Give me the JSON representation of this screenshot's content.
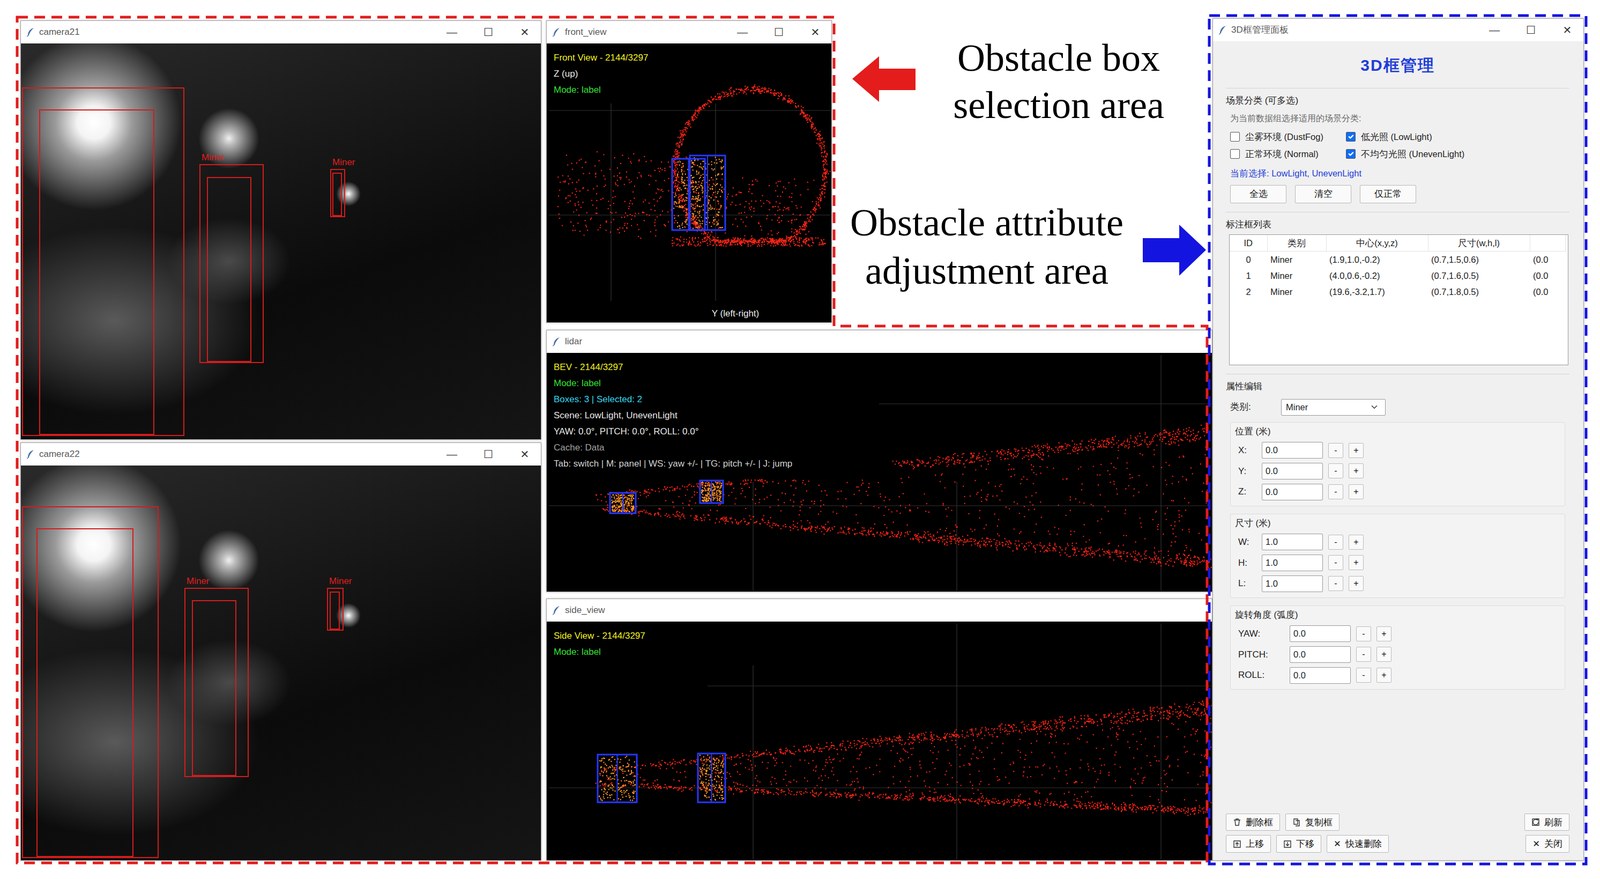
{
  "window_controls": [
    "—",
    "☐",
    "✕"
  ],
  "selection_label": {
    "lines": [
      "Obstacle box",
      "selection area"
    ]
  },
  "attribute_label": {
    "lines": [
      "Obstacle attribute",
      "adjustment area"
    ]
  },
  "cameras": [
    {
      "title": "camera21",
      "boxes": [
        {},
        {
          "label": "Miner"
        },
        {
          "label": "Miner"
        }
      ]
    },
    {
      "title": "camera22",
      "boxes": [
        {},
        {
          "label": "Miner"
        },
        {
          "label": "Miner"
        }
      ]
    }
  ],
  "front_view": {
    "title": "front_view",
    "lines": [
      {
        "text": "Front View - 2144/3297",
        "kind": "title"
      },
      {
        "text": "Z (up)",
        "kind": "axis"
      },
      {
        "text": "Mode: label",
        "kind": "mode"
      }
    ],
    "axis": "Y (left-right)"
  },
  "lidar": {
    "title": "lidar",
    "lines": [
      {
        "text": "BEV - 2144/3297",
        "kind": "title"
      },
      {
        "text": "Mode: label",
        "kind": "mode"
      },
      {
        "text": "Boxes: 3 | Selected: 2",
        "kind": "count"
      },
      {
        "text": "Scene: LowLight, UnevenLight",
        "kind": "info"
      },
      {
        "text": "YAW: 0.0°, PITCH: 0.0°, ROLL: 0.0°",
        "kind": "info"
      },
      {
        "text": "Cache: Data",
        "kind": "cache"
      },
      {
        "text": "Tab: switch | M: panel | WS: yaw +/- | TG: pitch +/- | J: jump",
        "kind": "keys"
      }
    ]
  },
  "side_view": {
    "title": "side_view",
    "lines": [
      {
        "text": "Side View - 2144/3297",
        "kind": "title"
      },
      {
        "text": "Mode: label",
        "kind": "mode"
      }
    ]
  },
  "panel": {
    "title": "3D框管理面板",
    "heading": "3D框管理",
    "scene": {
      "title": "场景分类 (可多选)",
      "hint": "为当前数据组选择适用的场景分类:",
      "options": [
        {
          "label": "尘雾环境 (DustFog)",
          "checked": false
        },
        {
          "label": "低光照 (LowLight)",
          "checked": true
        },
        {
          "label": "正常环境 (Normal)",
          "checked": false
        },
        {
          "label": "不均匀光照 (UnevenLight)",
          "checked": true
        }
      ],
      "current": "当前选择: LowLight, UnevenLight",
      "buttons": [
        "全选",
        "清空",
        "仅正常"
      ]
    },
    "box_list": {
      "title": "标注框列表",
      "columns": [
        "ID",
        "类别",
        "中心(x,y,z)",
        "尺寸(w,h,l)"
      ],
      "rows": [
        [
          "0",
          "Miner",
          "(1.9,1.0,-0.2)",
          "(0.7,1.5,0.6)",
          "(0.0"
        ],
        [
          "1",
          "Miner",
          "(4.0,0.6,-0.2)",
          "(0.7,1.6,0.5)",
          "(0.0"
        ],
        [
          "2",
          "Miner",
          "(19.6,-3.2,1.7)",
          "(0.7,1.8,0.5)",
          "(0.0"
        ]
      ]
    },
    "attributes": {
      "title": "属性编辑",
      "category_label": "类别:",
      "category": "Miner",
      "minus": "-",
      "plus": "+",
      "groups": [
        {
          "title": "位置 (米)",
          "fields": [
            {
              "label": "X:",
              "value": "0.0"
            },
            {
              "label": "Y:",
              "value": "0.0"
            },
            {
              "label": "Z:",
              "value": "0.0"
            }
          ]
        },
        {
          "title": "尺寸 (米)",
          "fields": [
            {
              "label": "W:",
              "value": "1.0"
            },
            {
              "label": "H:",
              "value": "1.0"
            },
            {
              "label": "L:",
              "value": "1.0"
            }
          ]
        },
        {
          "title": "旋转角度 (弧度)",
          "fields": [
            {
              "label": "YAW:",
              "value": "0.0"
            },
            {
              "label": "PITCH:",
              "value": "0.0"
            },
            {
              "label": "ROLL:",
              "value": "0.0"
            }
          ]
        }
      ]
    },
    "footer": {
      "delete": "删除框",
      "copy": "复制框",
      "refresh": "刷新",
      "up": "上移",
      "down": "下移",
      "quick_delete": {
        "glyph": "✕",
        "label": "快速删除"
      },
      "close": {
        "glyph": "✕",
        "label": "关闭"
      }
    }
  }
}
